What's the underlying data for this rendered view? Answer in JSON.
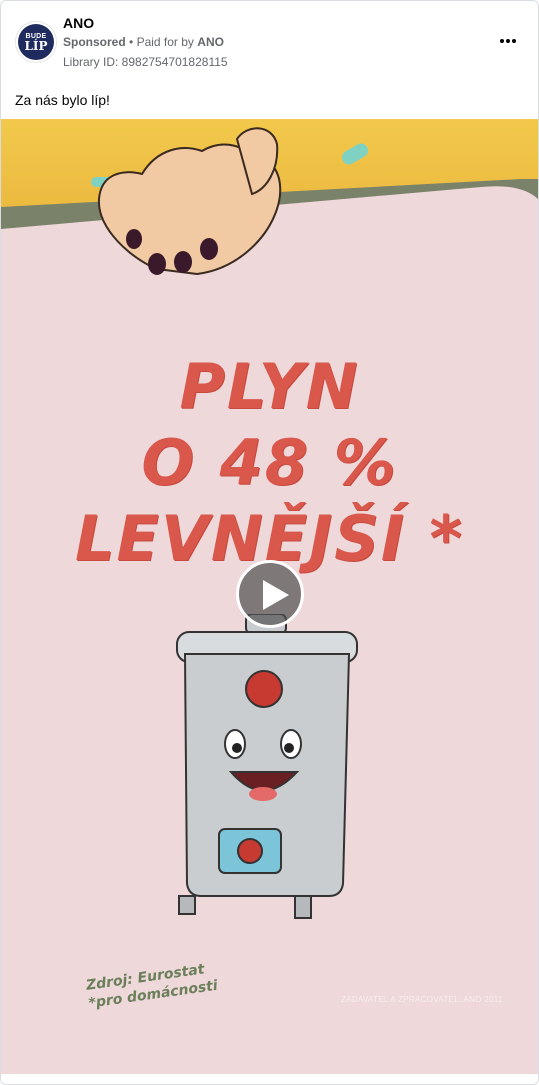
{
  "post": {
    "page_name": "ANO",
    "sponsored": "Sponsored",
    "paid_for": "Paid for by",
    "paid_by": "ANO",
    "library_id": "Library ID: 8982754701828115",
    "caption": "Za nás bylo líp!",
    "avatar_line1": "BUDE",
    "avatar_line2": "LÍP"
  },
  "ad": {
    "line1": "PLYN",
    "line2": "O 48 %",
    "line3": "LEVNĚJŠÍ *",
    "source_line1": "Zdroj: Eurostat",
    "source_line2": "*pro domácnosti",
    "zadavatel": "ZADAVATEL A ZPRACOVATEL: ANO 2011"
  },
  "colors": {
    "headline": "#d9574b",
    "background": "#eed8da",
    "top_band": "#f2c94c",
    "band_edge": "#7b826a"
  }
}
